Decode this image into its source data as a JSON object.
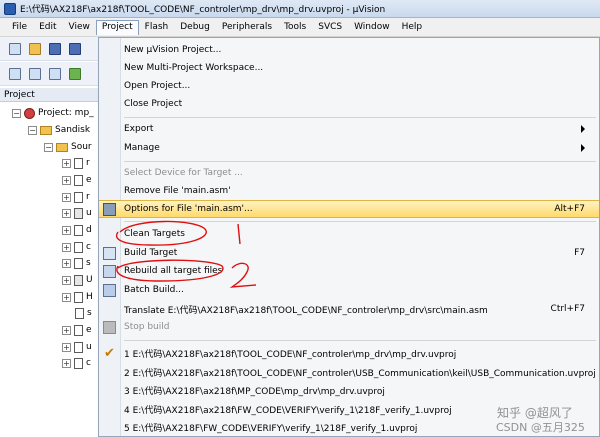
{
  "window": {
    "title": "E:\\代码\\AX218F\\ax218f\\TOOL_CODE\\NF_controler\\mp_drv\\mp_drv.uvproj - µVision"
  },
  "menubar": [
    "File",
    "Edit",
    "View",
    "Project",
    "Flash",
    "Debug",
    "Peripherals",
    "Tools",
    "SVCS",
    "Window",
    "Help"
  ],
  "panel": {
    "title": "Project"
  },
  "tree": {
    "project": "Project: mp_",
    "target": "Sandisk",
    "group": "Sour",
    "files": [
      "r",
      "e",
      "r",
      "u",
      "d",
      "c",
      "s",
      "U",
      "H",
      "s",
      "e",
      "u",
      "c"
    ]
  },
  "menu": {
    "new_project": "New µVision Project...",
    "new_multi": "New Multi-Project Workspace...",
    "open_project": "Open Project...",
    "close_project": "Close Project",
    "export": "Export",
    "manage": "Manage",
    "select_device": "Select Device for Target ...",
    "remove_file": "Remove File 'main.asm'",
    "options_file": "Options for File 'main.asm'...",
    "options_shortcut": "Alt+F7",
    "clean_targets": "Clean Targets",
    "build_target": "Build Target",
    "build_shortcut": "F7",
    "rebuild_all": "Rebuild all target files",
    "batch_build": "Batch Build...",
    "translate": "Translate E:\\代码\\AX218F\\ax218f\\TOOL_CODE\\NF_controler\\mp_drv\\src\\main.asm",
    "translate_shortcut": "Ctrl+F7",
    "stop_build": "Stop build",
    "recent": [
      "1 E:\\代码\\AX218F\\ax218f\\TOOL_CODE\\NF_controler\\mp_drv\\mp_drv.uvproj",
      "2 E:\\代码\\AX218F\\ax218f\\TOOL_CODE\\NF_controler\\USB_Communication\\keil\\USB_Communication.uvproj",
      "3 E:\\代码\\AX218F\\ax218f\\MP_CODE\\mp_drv\\mp_drv.uvproj",
      "4 E:\\代码\\AX218F\\ax218f\\FW_CODE\\VERIFY\\verify_1\\218F_verify_1.uvproj",
      "5 E:\\代码\\AX218F\\FW_CODE\\VERIFY\\verify_1\\218F_verify_1.uvproj"
    ]
  },
  "annotations": {
    "one": "1",
    "two": "2"
  },
  "watermark": {
    "line1": "知乎 @超风了",
    "line2": "CSDN @五月325"
  },
  "colors": {
    "annotation": "#e01010",
    "highlight": "#ffd96a"
  }
}
